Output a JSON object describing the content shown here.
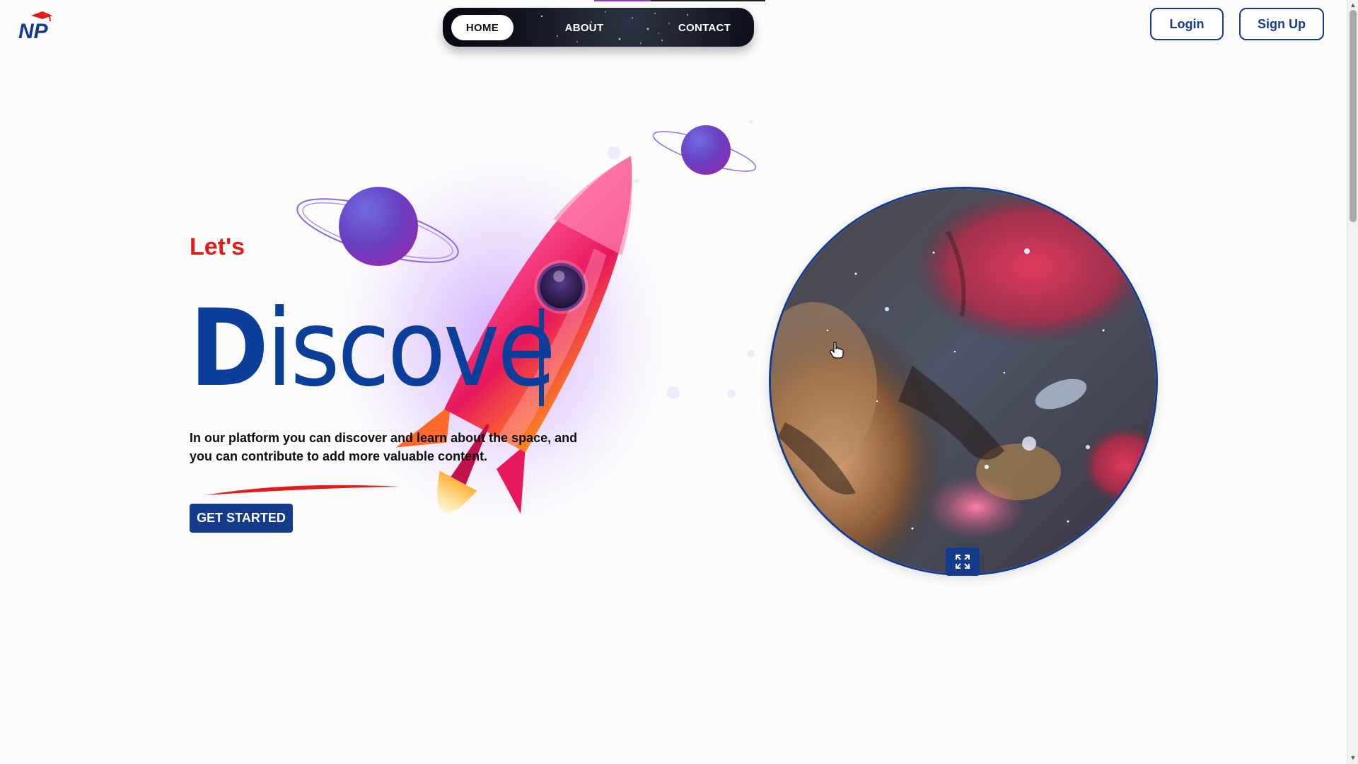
{
  "header": {
    "logo_text": "NP",
    "nav": [
      {
        "label": "HOME",
        "active": true
      },
      {
        "label": "ABOUT",
        "active": false
      },
      {
        "label": "CONTACT",
        "active": false
      }
    ],
    "login_label": "Login",
    "signup_label": "Sign Up"
  },
  "hero": {
    "kicker": "Let's",
    "headline_cap": "D",
    "headline_rest": "iscove",
    "description": "In our platform you can discover and learn about the space, and you can contribute to add more valuable content.",
    "cta_label": "GET STARTED"
  },
  "media": {
    "image_subject": "nebula-image",
    "expand_icon": "expand-icon"
  },
  "colors": {
    "brand_blue": "#143b8c",
    "headline_blue": "#0c3f99",
    "accent_red": "#e21b1b",
    "rocket_pink": "#e8185d",
    "planet_purple": "#6a3fc4",
    "page_bg": "#fcfcfc"
  }
}
